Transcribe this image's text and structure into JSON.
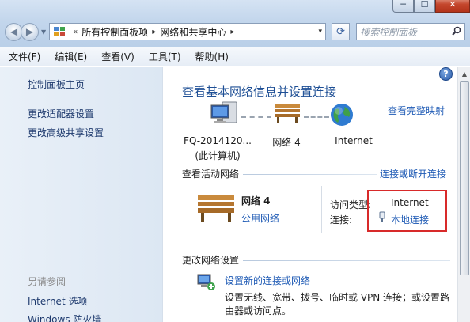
{
  "window": {
    "minimize_glyph": "─",
    "maximize_glyph": "☐",
    "close_glyph": "✕"
  },
  "address_bar": {
    "overflow_glyph": "«",
    "crumbs": [
      "所有控制面板项",
      "网络和共享中心"
    ],
    "separator": "▸",
    "dropdown_glyph": "▾"
  },
  "search": {
    "placeholder": "搜索控制面板",
    "icon": "magnifier-icon"
  },
  "menu": {
    "items": [
      "文件(F)",
      "编辑(E)",
      "查看(V)",
      "工具(T)",
      "帮助(H)"
    ]
  },
  "sidebar": {
    "items": [
      "控制面板主页",
      "更改适配器设置",
      "更改高级共享设置"
    ],
    "see_also_title": "另请参阅",
    "see_also_items": [
      "Internet 选项",
      "Windows 防火墙"
    ]
  },
  "main": {
    "help_glyph": "?",
    "heading": "查看基本网络信息并设置连接",
    "full_map_link": "查看完整映射",
    "map_nodes": {
      "computer_name": "FQ-2014120...",
      "computer_sub": "(此计算机)",
      "network": "网络  4",
      "internet": "Internet"
    },
    "active_networks_title": "查看活动网络",
    "connect_disconnect_link": "连接或断开连接",
    "network": {
      "name": "网络  4",
      "type": "公用网络",
      "access_type_label": "访问类型:",
      "access_type_value": "Internet",
      "connection_label": "连接:",
      "connection_value": "本地连接"
    },
    "change_settings_title": "更改网络设置",
    "task": {
      "link": "设置新的连接或网络",
      "desc": "设置无线、宽带、拨号、临时或 VPN 连接；或设置路由器或访问点。"
    }
  },
  "colors": {
    "link": "#1f5bb5",
    "heading": "#1e4f95",
    "highlight_box": "#d82a2a"
  }
}
